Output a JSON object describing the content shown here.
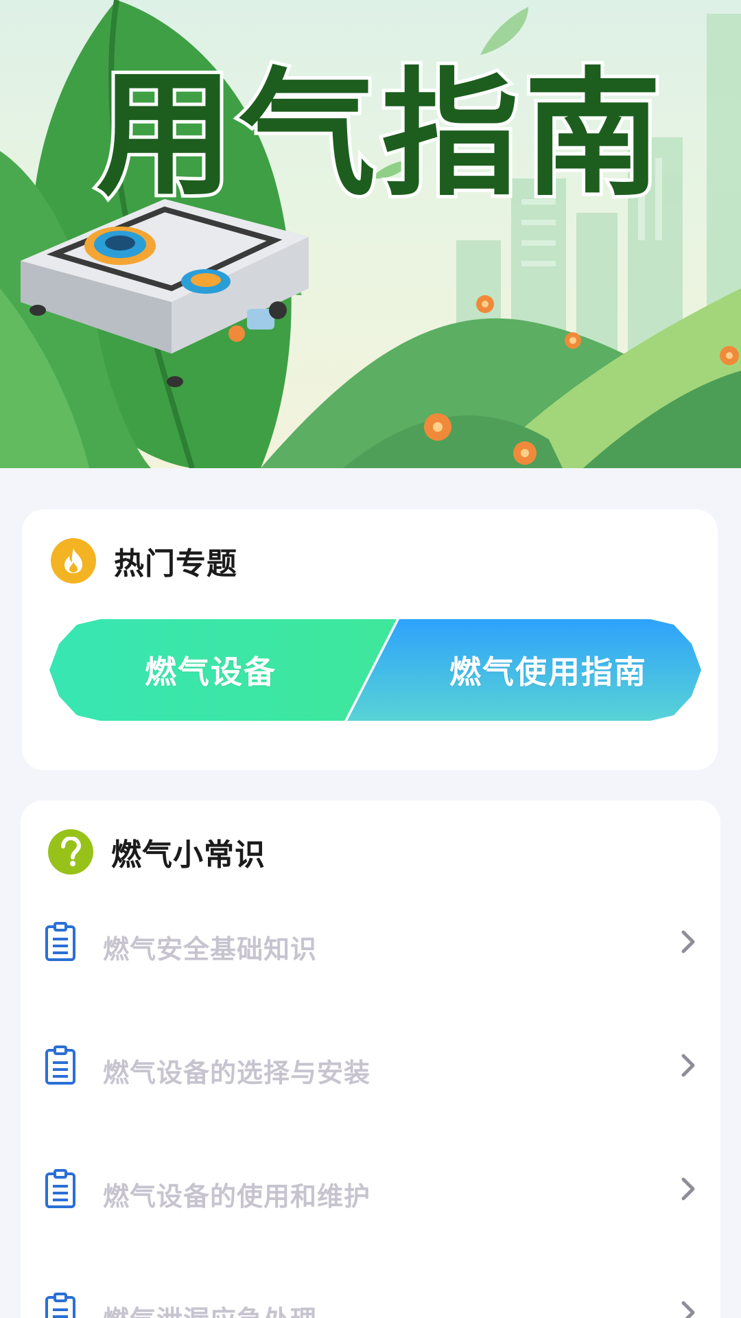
{
  "banner": {
    "title": "用气指南"
  },
  "hot_topics": {
    "title": "热门专题",
    "icon": "fire-icon",
    "icon_bg": "#f4b322",
    "buttons": [
      {
        "label": "燃气设备",
        "color": "#3fe79a"
      },
      {
        "label": "燃气使用指南",
        "color": "#2ea2fb"
      }
    ]
  },
  "tips": {
    "title": "燃气小常识",
    "icon": "question-icon",
    "icon_bg": "#97c21a",
    "items": [
      {
        "label": "燃气安全基础知识"
      },
      {
        "label": "燃气设备的选择与安装"
      },
      {
        "label": "燃气设备的使用和维护"
      },
      {
        "label": "燃气泄漏应急处理"
      }
    ]
  },
  "colors": {
    "page_bg": "#f3f5fa",
    "title_green": "#1d5e1e",
    "item_text": "#c7c4d0",
    "item_icon": "#2a6fd6"
  }
}
